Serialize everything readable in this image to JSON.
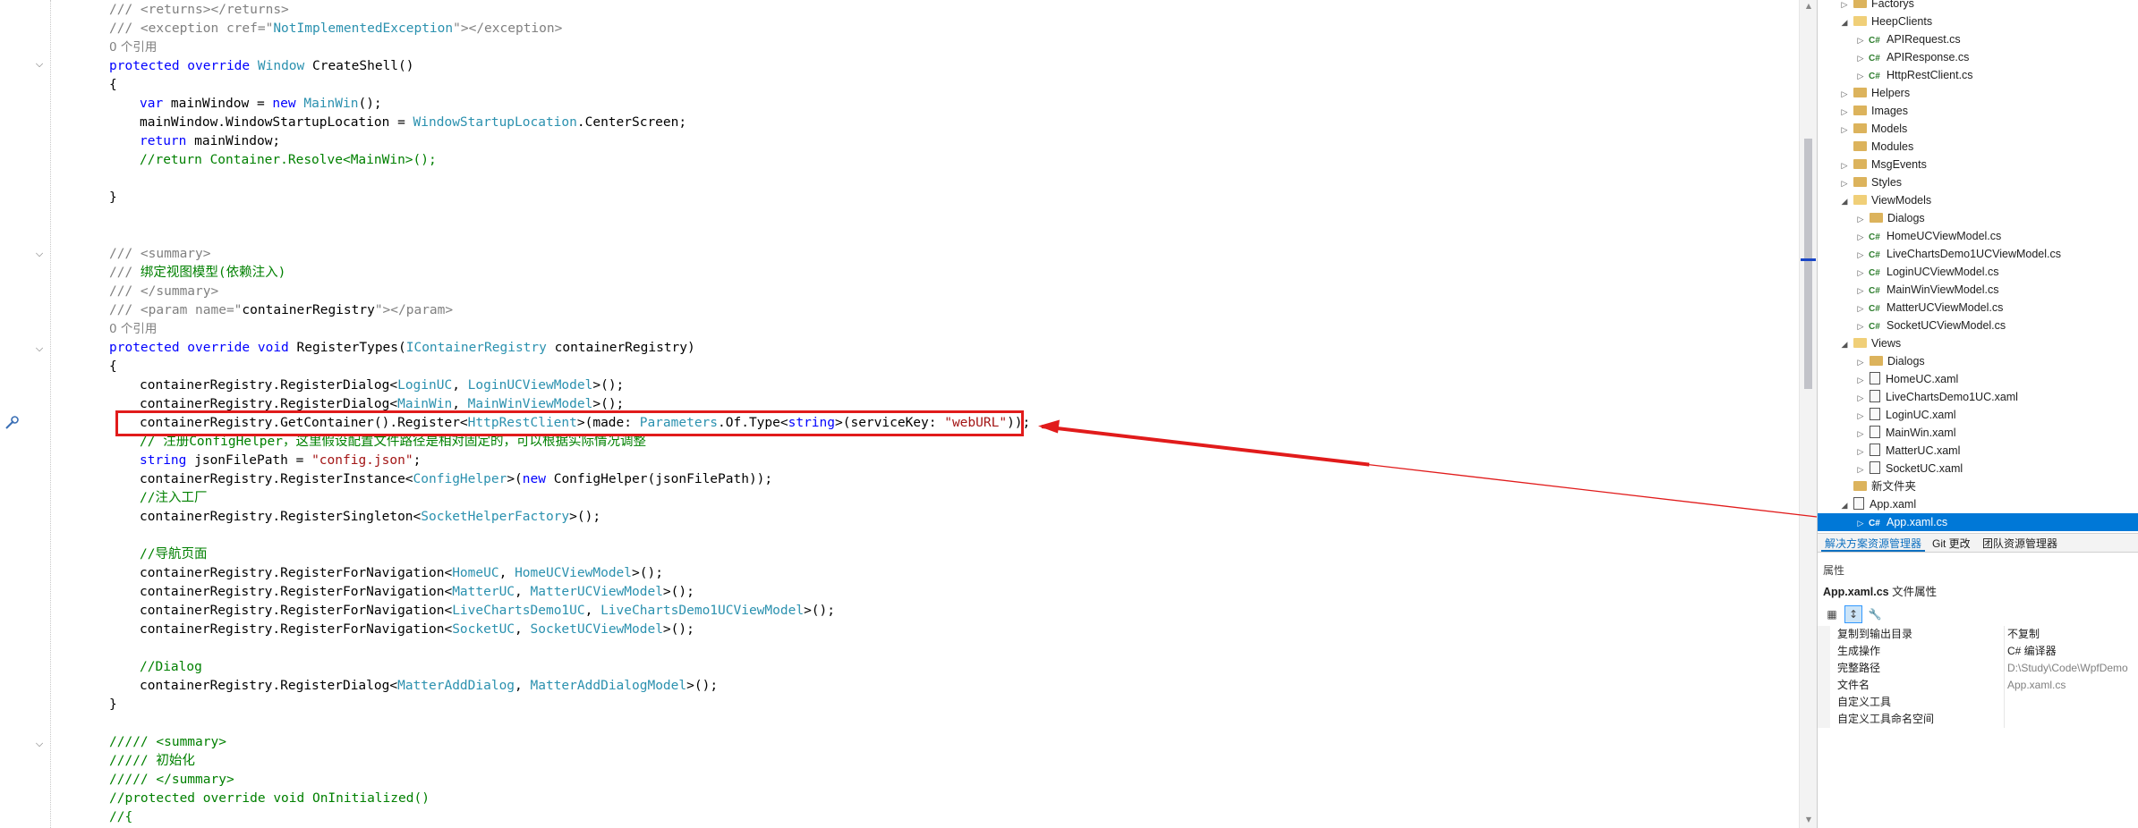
{
  "editor": {
    "lines": [
      [
        {
          "t": "/// ",
          "c": "xd"
        },
        {
          "t": "<returns></returns>",
          "c": "xd"
        }
      ],
      [
        {
          "t": "/// ",
          "c": "xd"
        },
        {
          "t": "<exception cref=\"",
          "c": "xd"
        },
        {
          "t": "NotImplementedException",
          "c": "ty"
        },
        {
          "t": "\"></exception>",
          "c": "xd"
        }
      ],
      [
        {
          "t": "0 个引用",
          "c": "ref"
        }
      ],
      [
        {
          "t": "protected override ",
          "c": "kw"
        },
        {
          "t": "Window",
          "c": "ty"
        },
        {
          "t": " CreateShell()",
          "c": ""
        }
      ],
      [
        {
          "t": "{",
          "c": ""
        }
      ],
      [
        {
          "t": "var",
          "c": "kw"
        },
        {
          "t": " mainWindow = ",
          "c": ""
        },
        {
          "t": "new",
          "c": "kw"
        },
        {
          "t": " ",
          "c": ""
        },
        {
          "t": "MainWin",
          "c": "ty"
        },
        {
          "t": "();",
          "c": ""
        }
      ],
      [
        {
          "t": "mainWindow.WindowStartupLocation = ",
          "c": ""
        },
        {
          "t": "WindowStartupLocation",
          "c": "ty"
        },
        {
          "t": ".CenterScreen;",
          "c": ""
        }
      ],
      [
        {
          "t": "return",
          "c": "kw"
        },
        {
          "t": " mainWindow;",
          "c": ""
        }
      ],
      [
        {
          "t": "//return Container.Resolve<MainWin>();",
          "c": "cm"
        }
      ],
      [],
      [
        {
          "t": "}",
          "c": ""
        }
      ],
      [],
      [],
      [
        {
          "t": "/// ",
          "c": "xd"
        },
        {
          "t": "<summary>",
          "c": "xd"
        }
      ],
      [
        {
          "t": "/// ",
          "c": "xd"
        },
        {
          "t": "绑定视图模型(依赖注入)",
          "c": "cm"
        }
      ],
      [
        {
          "t": "/// ",
          "c": "xd"
        },
        {
          "t": "</summary>",
          "c": "xd"
        }
      ],
      [
        {
          "t": "/// ",
          "c": "xd"
        },
        {
          "t": "<param name=\"",
          "c": "xd"
        },
        {
          "t": "containerRegistry",
          "c": ""
        },
        {
          "t": "\"></param>",
          "c": "xd"
        }
      ],
      [
        {
          "t": "0 个引用",
          "c": "ref"
        }
      ],
      [
        {
          "t": "protected override void ",
          "c": "kw"
        },
        {
          "t": "RegisterTypes(",
          "c": ""
        },
        {
          "t": "IContainerRegistry",
          "c": "ty"
        },
        {
          "t": " containerRegistry)",
          "c": ""
        }
      ],
      [
        {
          "t": "{",
          "c": ""
        }
      ],
      [
        {
          "t": "containerRegistry.RegisterDialog<",
          "c": ""
        },
        {
          "t": "LoginUC",
          "c": "ty"
        },
        {
          "t": ", ",
          "c": ""
        },
        {
          "t": "LoginUCViewModel",
          "c": "ty"
        },
        {
          "t": ">();",
          "c": ""
        }
      ],
      [
        {
          "t": "containerRegistry.RegisterDialog<",
          "c": ""
        },
        {
          "t": "MainWin",
          "c": "ty"
        },
        {
          "t": ", ",
          "c": ""
        },
        {
          "t": "MainWinViewModel",
          "c": "ty"
        },
        {
          "t": ">();",
          "c": ""
        }
      ],
      [
        {
          "t": "containerRegistry.GetContainer().Register<",
          "c": ""
        },
        {
          "t": "HttpRestClient",
          "c": "ty"
        },
        {
          "t": ">(made: ",
          "c": ""
        },
        {
          "t": "Parameters",
          "c": "ty"
        },
        {
          "t": ".Of.Type<",
          "c": ""
        },
        {
          "t": "string",
          "c": "kw"
        },
        {
          "t": ">(serviceKey: ",
          "c": ""
        },
        {
          "t": "\"webURL\"",
          "c": "st"
        },
        {
          "t": "));",
          "c": ""
        }
      ],
      [
        {
          "t": "// 注册ConfigHelper，这里假设配置文件路径是相对固定的，可以根据实际情况调整",
          "c": "cm"
        }
      ],
      [
        {
          "t": "string",
          "c": "kw"
        },
        {
          "t": " jsonFilePath = ",
          "c": ""
        },
        {
          "t": "\"config.json\"",
          "c": "st"
        },
        {
          "t": ";",
          "c": ""
        }
      ],
      [
        {
          "t": "containerRegistry.RegisterInstance<",
          "c": ""
        },
        {
          "t": "ConfigHelper",
          "c": "ty"
        },
        {
          "t": ">(",
          "c": ""
        },
        {
          "t": "new",
          "c": "kw"
        },
        {
          "t": " ConfigHelper(jsonFilePath));",
          "c": ""
        }
      ],
      [
        {
          "t": "//注入工厂",
          "c": "cm"
        }
      ],
      [
        {
          "t": "containerRegistry.RegisterSingleton<",
          "c": ""
        },
        {
          "t": "SocketHelperFactory",
          "c": "ty"
        },
        {
          "t": ">();",
          "c": ""
        }
      ],
      [],
      [
        {
          "t": "//导航页面",
          "c": "cm"
        }
      ],
      [
        {
          "t": "containerRegistry.RegisterForNavigation<",
          "c": ""
        },
        {
          "t": "HomeUC",
          "c": "ty"
        },
        {
          "t": ", ",
          "c": ""
        },
        {
          "t": "HomeUCViewModel",
          "c": "ty"
        },
        {
          "t": ">();",
          "c": ""
        }
      ],
      [
        {
          "t": "containerRegistry.RegisterForNavigation<",
          "c": ""
        },
        {
          "t": "MatterUC",
          "c": "ty"
        },
        {
          "t": ", ",
          "c": ""
        },
        {
          "t": "MatterUCViewModel",
          "c": "ty"
        },
        {
          "t": ">();",
          "c": ""
        }
      ],
      [
        {
          "t": "containerRegistry.RegisterForNavigation<",
          "c": ""
        },
        {
          "t": "LiveChartsDemo1UC",
          "c": "ty"
        },
        {
          "t": ", ",
          "c": ""
        },
        {
          "t": "LiveChartsDemo1UCViewModel",
          "c": "ty"
        },
        {
          "t": ">();",
          "c": ""
        }
      ],
      [
        {
          "t": "containerRegistry.RegisterForNavigation<",
          "c": ""
        },
        {
          "t": "SocketUC",
          "c": "ty"
        },
        {
          "t": ", ",
          "c": ""
        },
        {
          "t": "SocketUCViewModel",
          "c": "ty"
        },
        {
          "t": ">();",
          "c": ""
        }
      ],
      [],
      [
        {
          "t": "//Dialog",
          "c": "cm"
        }
      ],
      [
        {
          "t": "containerRegistry.RegisterDialog<",
          "c": ""
        },
        {
          "t": "MatterAddDialog",
          "c": "ty"
        },
        {
          "t": ", ",
          "c": ""
        },
        {
          "t": "MatterAddDialogModel",
          "c": "ty"
        },
        {
          "t": ">();",
          "c": ""
        }
      ],
      [
        {
          "t": "}",
          "c": ""
        }
      ],
      [],
      [
        {
          "t": "///// <summary>",
          "c": "cm"
        }
      ],
      [
        {
          "t": "///// 初始化",
          "c": "cm"
        }
      ],
      [
        {
          "t": "///// </summary>",
          "c": "cm"
        }
      ],
      [
        {
          "t": "//protected override void OnInitialized()",
          "c": "cm"
        }
      ],
      [
        {
          "t": "//{",
          "c": "cm"
        }
      ]
    ]
  },
  "solution_explorer": {
    "items": [
      {
        "label": "Factorys",
        "kind": "folder",
        "level": 1,
        "expander": "closed"
      },
      {
        "label": "HeepClients",
        "kind": "folder-open",
        "level": 1,
        "expander": "open"
      },
      {
        "label": "APIRequest.cs",
        "kind": "cs",
        "level": 2,
        "expander": "closed"
      },
      {
        "label": "APIResponse.cs",
        "kind": "cs",
        "level": 2,
        "expander": "closed"
      },
      {
        "label": "HttpRestClient.cs",
        "kind": "cs",
        "level": 2,
        "expander": "closed"
      },
      {
        "label": "Helpers",
        "kind": "folder",
        "level": 1,
        "expander": "closed"
      },
      {
        "label": "Images",
        "kind": "folder",
        "level": 1,
        "expander": "closed"
      },
      {
        "label": "Models",
        "kind": "folder",
        "level": 1,
        "expander": "closed"
      },
      {
        "label": "Modules",
        "kind": "folder",
        "level": 1,
        "expander": "none"
      },
      {
        "label": "MsgEvents",
        "kind": "folder",
        "level": 1,
        "expander": "closed"
      },
      {
        "label": "Styles",
        "kind": "folder",
        "level": 1,
        "expander": "closed"
      },
      {
        "label": "ViewModels",
        "kind": "folder-open",
        "level": 1,
        "expander": "open"
      },
      {
        "label": "Dialogs",
        "kind": "folder",
        "level": 2,
        "expander": "closed"
      },
      {
        "label": "HomeUCViewModel.cs",
        "kind": "cs",
        "level": 2,
        "expander": "closed"
      },
      {
        "label": "LiveChartsDemo1UCViewModel.cs",
        "kind": "cs",
        "level": 2,
        "expander": "closed"
      },
      {
        "label": "LoginUCViewModel.cs",
        "kind": "cs",
        "level": 2,
        "expander": "closed"
      },
      {
        "label": "MainWinViewModel.cs",
        "kind": "cs",
        "level": 2,
        "expander": "closed"
      },
      {
        "label": "MatterUCViewModel.cs",
        "kind": "cs",
        "level": 2,
        "expander": "closed"
      },
      {
        "label": "SocketUCViewModel.cs",
        "kind": "cs",
        "level": 2,
        "expander": "closed"
      },
      {
        "label": "Views",
        "kind": "folder-open",
        "level": 1,
        "expander": "open"
      },
      {
        "label": "Dialogs",
        "kind": "folder",
        "level": 2,
        "expander": "closed"
      },
      {
        "label": "HomeUC.xaml",
        "kind": "xaml",
        "level": 2,
        "expander": "closed"
      },
      {
        "label": "LiveChartsDemo1UC.xaml",
        "kind": "xaml",
        "level": 2,
        "expander": "closed"
      },
      {
        "label": "LoginUC.xaml",
        "kind": "xaml",
        "level": 2,
        "expander": "closed"
      },
      {
        "label": "MainWin.xaml",
        "kind": "xaml",
        "level": 2,
        "expander": "closed"
      },
      {
        "label": "MatterUC.xaml",
        "kind": "xaml",
        "level": 2,
        "expander": "closed"
      },
      {
        "label": "SocketUC.xaml",
        "kind": "xaml",
        "level": 2,
        "expander": "closed"
      },
      {
        "label": "新文件夹",
        "kind": "folder",
        "level": 1,
        "expander": "none"
      },
      {
        "label": "App.xaml",
        "kind": "xaml",
        "level": 1,
        "expander": "open"
      },
      {
        "label": "App.xaml.cs",
        "kind": "cs",
        "level": 2,
        "expander": "closed",
        "selected": true
      }
    ],
    "tabs": [
      "解决方案资源管理器",
      "Git 更改",
      "团队资源管理器"
    ]
  },
  "properties": {
    "header": "属性",
    "file_name": "App.xaml.cs",
    "file_kind": "文件属性",
    "rows": [
      {
        "name": "复制到输出目录",
        "value": "不复制"
      },
      {
        "name": "生成操作",
        "value": "C# 编译器"
      },
      {
        "name": "完整路径",
        "value": "D:\\Study\\Code\\WpfDemo",
        "dim": true
      },
      {
        "name": "文件名",
        "value": "App.xaml.cs",
        "dim": true
      },
      {
        "name": "自定义工具",
        "value": ""
      },
      {
        "name": "自定义工具命名空间",
        "value": ""
      }
    ]
  },
  "colors": {
    "highlight_border": "#e11b1b",
    "arrow": "#e11b1b",
    "selection": "#0078d7",
    "tab_accent": "#0e70c0"
  }
}
